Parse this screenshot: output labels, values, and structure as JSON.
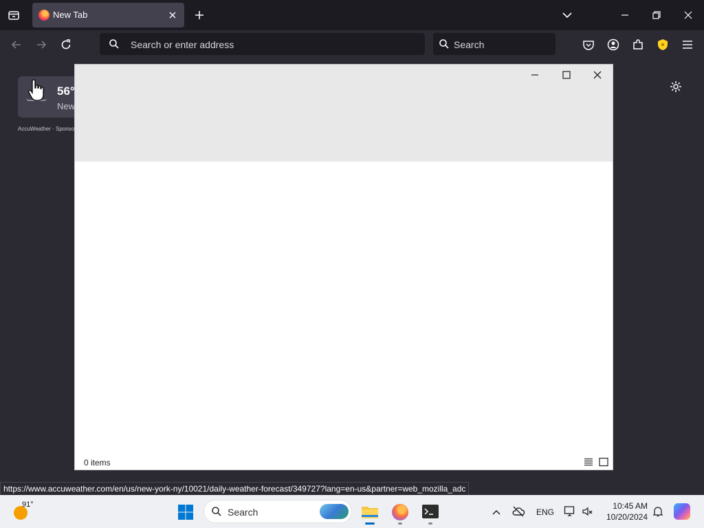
{
  "browser": {
    "tab": {
      "title": "New Tab"
    },
    "urlbar": {
      "placeholder": "Search or enter address"
    },
    "searchbar": {
      "placeholder": "Search"
    }
  },
  "newtab": {
    "weather": {
      "temp": "56°",
      "location": "New",
      "sponsor": "AccuWeather · Sponsored"
    }
  },
  "dialog": {
    "status": "0 items"
  },
  "status_url": "https://www.accuweather.com/en/us/new-york-ny/10021/daily-weather-forecast/349727?lang=en-us&partner=web_mozilla_adc",
  "taskbar": {
    "weather_temp": "91°",
    "search_label": "Search",
    "language": "ENG",
    "time": "10:45 AM",
    "date": "10/20/2024"
  },
  "colors": {
    "accent": "#0060df",
    "shield": "#ffd21f"
  }
}
